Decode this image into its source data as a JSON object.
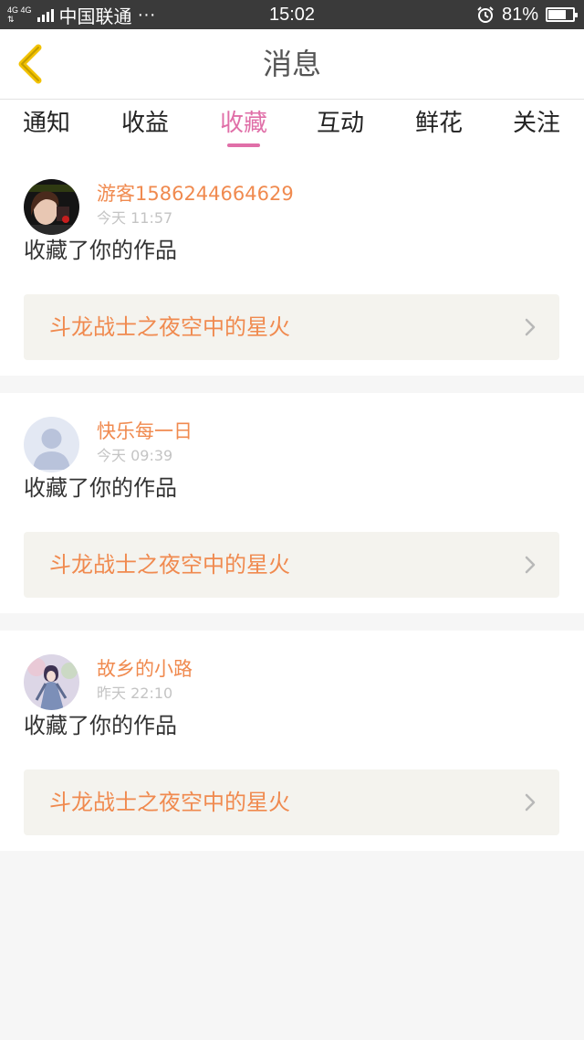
{
  "status_bar": {
    "network_badge_top": "4G 4G",
    "network_badge_bottom": "⇅",
    "carrier": "中国联通",
    "more": "···",
    "time": "15:02",
    "alarm_icon": "alarm-clock-icon",
    "battery_percent_text": "81%",
    "battery_level": 0.81
  },
  "header": {
    "back_icon": "chevron-left-icon",
    "title": "消息",
    "accent_color": "#f2c200"
  },
  "tabs": [
    {
      "label": "通知",
      "active": false
    },
    {
      "label": "收益",
      "active": false
    },
    {
      "label": "收藏",
      "active": true
    },
    {
      "label": "互动",
      "active": false
    },
    {
      "label": "鲜花",
      "active": false
    },
    {
      "label": "关注",
      "active": false
    }
  ],
  "colors": {
    "active_tab": "#e06fa8",
    "username": "#f08a4f",
    "work_title": "#f08a4f",
    "timestamp": "#c4c4c4"
  },
  "messages": [
    {
      "avatar": "photo-avatar",
      "username": "游客1586244664629",
      "timestamp": "今天 11:57",
      "action": "收藏了你的作品",
      "work_title": "斗龙战士之夜空中的星火"
    },
    {
      "avatar": "default-user-avatar",
      "username": "快乐每一日",
      "timestamp": "今天 09:39",
      "action": "收藏了你的作品",
      "work_title": "斗龙战士之夜空中的星火"
    },
    {
      "avatar": "illustration-avatar",
      "username": "故乡的小路",
      "timestamp": "昨天 22:10",
      "action": "收藏了你的作品",
      "work_title": "斗龙战士之夜空中的星火"
    }
  ]
}
